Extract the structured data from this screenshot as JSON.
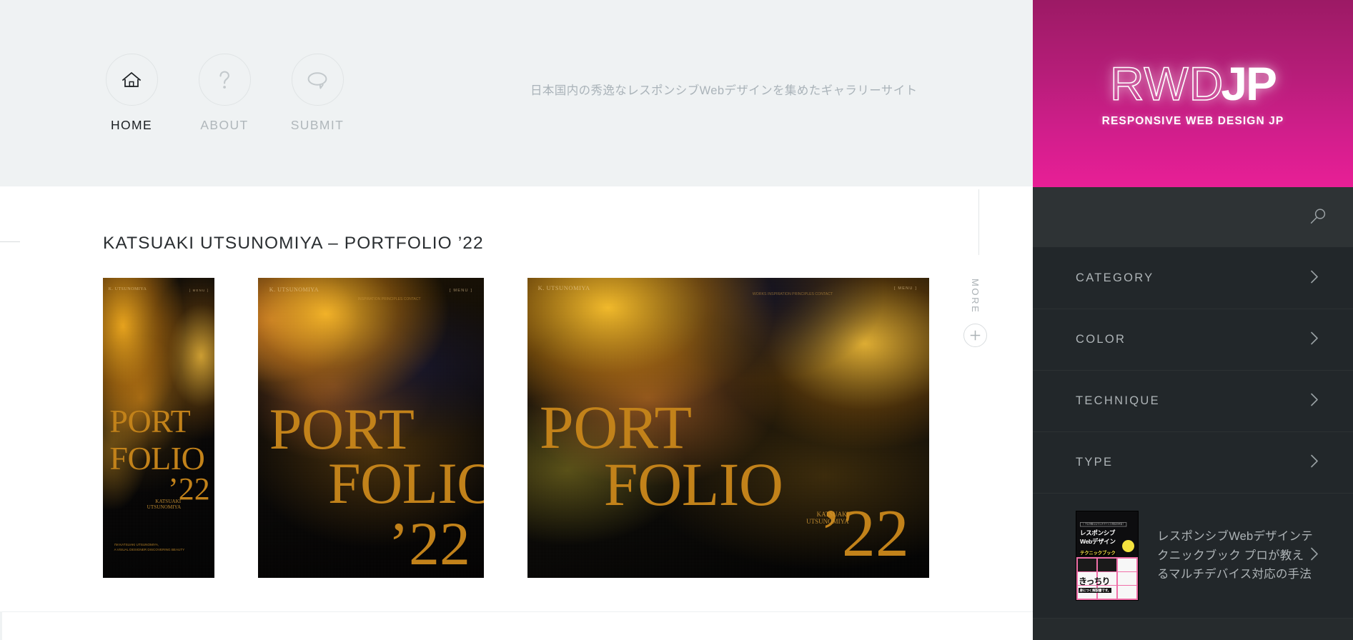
{
  "header": {
    "tagline": "日本国内の秀逸なレスポンシブWebデザインを集めたギャラリーサイト",
    "nav": [
      {
        "label": "HOME",
        "icon": "home-icon",
        "active": true
      },
      {
        "label": "ABOUT",
        "icon": "question-icon",
        "active": false
      },
      {
        "label": "SUBMIT",
        "icon": "speech-bubble-icon",
        "active": false
      }
    ]
  },
  "main": {
    "entry_title": "KATSUAKI UTSUNOMIYA – PORTFOLIO ’22",
    "more_label": "MORE",
    "more_icon": "plus-icon",
    "screenshots": [
      {
        "device": "mobile",
        "brand": "K.\nUTSUNOMIYA",
        "menu": "[ MENU ]",
        "nav": "",
        "headline_1": "PORT",
        "headline_2": "FOLIO",
        "year": "’22",
        "credit": "KATSUAKI\nUTSUNOMIYA",
        "blurb": "I’M KATSUAKI UTSUNOMIYA,\nA VISUAL DESIGNER DISCOVERING BEAUTY"
      },
      {
        "device": "tablet",
        "brand": "K.\nUTSUNOMIYA",
        "menu": "[ MENU ]",
        "nav": "INSPIRATION\nPRINCIPLES\nCONTACT",
        "headline_1": "PORT",
        "headline_2": "FOLIO",
        "year": "’22",
        "credit": "",
        "blurb": ""
      },
      {
        "device": "desktop",
        "brand": "K.\nUTSUNOMIYA",
        "menu": "[ MENU ]",
        "nav": "WORKS\nINSPIRATION\nPRINCIPLES\nCONTACT",
        "headline_1": "PORT",
        "headline_2": "FOLIO",
        "year": "’22",
        "credit": "KATSUAKI\nUTSUNOMIYA",
        "blurb": ""
      }
    ]
  },
  "sidebar": {
    "logo": {
      "mark_light": "RWD",
      "mark_bold": "JP",
      "subtitle": "RESPONSIVE WEB DESIGN JP"
    },
    "search": {
      "icon": "search-icon"
    },
    "filters": [
      {
        "label": "CATEGORY",
        "icon": "chevron-right-icon"
      },
      {
        "label": "COLOR",
        "icon": "chevron-right-icon"
      },
      {
        "label": "TECHNIQUE",
        "icon": "chevron-right-icon"
      },
      {
        "label": "TYPE",
        "icon": "chevron-right-icon"
      }
    ],
    "promo": {
      "title": "レスポンシブWebデザインテクニックブック プロが教えるマルチデバイス対応の手法",
      "icon": "chevron-right-icon",
      "cover": {
        "ribbon": "［ プロが教えるマルチデバイス対応の手法 ］",
        "line1": "レスポンシブ",
        "line2": "Webデザイン",
        "line3": "テクニックブック",
        "band": "きっちり",
        "band_sub": "身につく解説書です。"
      }
    }
  },
  "colors": {
    "brand_pink_top": "#9c1a65",
    "brand_pink_bottom": "#e81f96",
    "sidebar_bg": "#22272a",
    "search_bg": "#2e3335",
    "header_bg": "#eff2f3",
    "accent_amber": "#c2821a"
  }
}
